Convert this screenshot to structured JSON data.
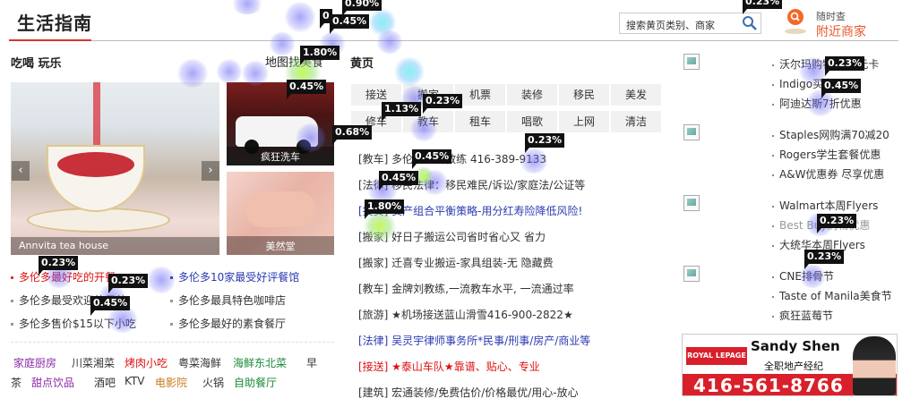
{
  "header": {
    "title": "生活指南",
    "search_placeholder": "搜索黄页类别、商家",
    "nearby_line1": "随时查",
    "nearby_line2": "附近商家"
  },
  "eat_play": {
    "heading": "吃喝 玩乐",
    "map_link": "地图找美食",
    "hero_caption": "Annvita tea house",
    "car_caption": "疯狂洗车",
    "nail_caption": "美然堂",
    "left_links": [
      "多伦多最好吃的开餐",
      "多伦多最受欢迎的早茶",
      "多伦多售价$15以下小吃"
    ],
    "right_links": [
      "多伦多10家最受好评餐馆",
      "多伦多最具特色咖啡店",
      "多伦多最好的素食餐厅"
    ],
    "tags": [
      {
        "label": "家庭厨房",
        "color": "#8a2aa8"
      },
      {
        "label": "川菜湘菜",
        "color": "#333333"
      },
      {
        "label": "烤肉小吃",
        "color": "#d11111"
      },
      {
        "label": "粤菜海鲜",
        "color": "#333333"
      },
      {
        "label": "海鲜东北菜",
        "color": "#1a8a3a"
      },
      {
        "label": "早",
        "color": "#333333"
      },
      {
        "label": "茶",
        "color": "#333333"
      },
      {
        "label": "甜点饮品",
        "color": "#8a2aa8"
      },
      {
        "label": "酒吧",
        "color": "#333333"
      },
      {
        "label": "KTV",
        "color": "#333333"
      },
      {
        "label": "电影院",
        "color": "#c8781a"
      },
      {
        "label": "火锅",
        "color": "#333333"
      },
      {
        "label": "自助餐厅",
        "color": "#1a8a3a"
      }
    ]
  },
  "yellow_pages": {
    "heading": "黄页",
    "categories": [
      "接送",
      "搬家",
      "机票",
      "装修",
      "移民",
      "美发",
      "修车",
      "教车",
      "租车",
      "唱歌",
      "上网",
      "清洁"
    ],
    "listings": [
      "[教车] 多伦多金牌教练 416-389-9133",
      "[法律] 移民法律：移民难民/诉讼/家庭法/公证等",
      "[投资] 资产组合平衡策略-用分红寿险降低风险!",
      "[搬家] 好日子搬运公司省时省心又 省力",
      "[搬家] 迁喜专业搬运-家具组装-无 隐藏费",
      "[教车] 金牌刘教练,一流教车水平, 一流通过率",
      "[旅游] ★机场接送蓝山滑雪416-900-2822★",
      "[法律] 吴灵宇律师事务所*民事/刑事/房产/商业等",
      "[接送] ★泰山车队★靠谱、贴心、专业",
      "[建筑] 宏通装修/免费估价/价格最优/用心-放心"
    ]
  },
  "deals": {
    "group1": [
      "沃尔玛购物卡10元卡",
      "Indigo买书",
      "阿迪达斯7折优惠"
    ],
    "group2": [
      "Staples网购满70减20",
      "Rogers学生套餐优惠",
      "A&W优惠券 尽享优惠"
    ],
    "group3": [
      "Walmart本周Flyers",
      "Best Buy购物优惠",
      "大统华本周Flyers"
    ],
    "group4": [
      "CNE排骨节",
      "Taste of Manila美食节",
      "疯狂蓝莓节"
    ]
  },
  "ad": {
    "logo": "ROYAL LEPAGE",
    "name": "Sandy Shen",
    "title": "全职地产经纪",
    "phone": "416-561-8766"
  },
  "heatmap_badges": [
    "0.90%",
    "0.45%",
    "0.23%",
    "1.80%",
    "0.45%",
    "0.68%",
    "1.13%",
    "0.23%",
    "0.23%",
    "0.45%",
    "0.45%",
    "1.80%",
    "0.23%",
    "0.23%",
    "0.45%",
    "0.23%",
    "0.45%",
    "0.23%",
    "0.23%"
  ],
  "colors": {
    "accent": "#d33333",
    "link_blue": "#2a3ab0",
    "orange": "#e8592a"
  }
}
